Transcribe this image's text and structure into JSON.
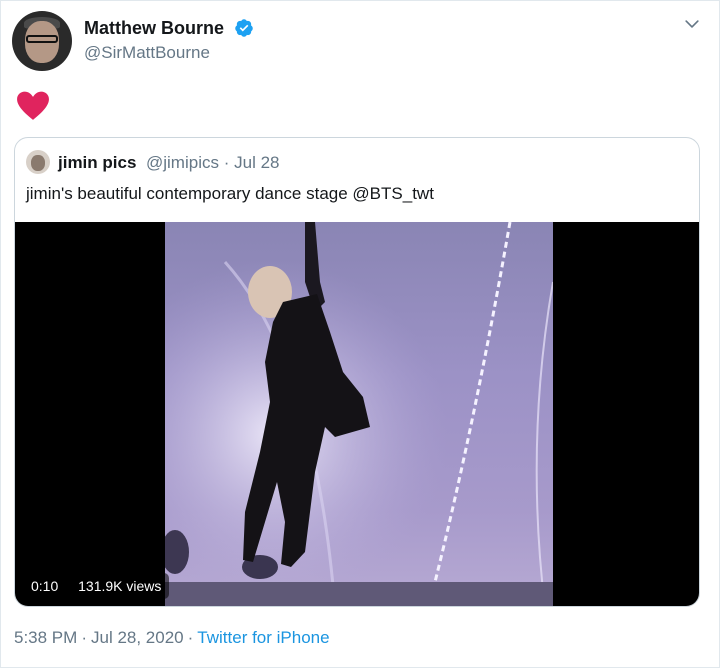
{
  "author": {
    "name": "Matthew Bourne",
    "handle": "@SirMattBourne",
    "verified_icon": "verified-badge-icon",
    "verified_color": "#1da1f2"
  },
  "tweet": {
    "content_icon": "red-heart-emoji",
    "heart_color": "#e0245e"
  },
  "quoted": {
    "name": "jimin pics",
    "handle": "@jimipics",
    "dot": "·",
    "date": "Jul 28",
    "text": "jimin's beautiful contemporary dance stage @BTS_twt",
    "video": {
      "duration": "0:10",
      "views": "131.9K views"
    }
  },
  "footer": {
    "time": "5:38 PM",
    "dot1": "·",
    "date": "Jul 28, 2020",
    "dot2": "·",
    "source": "Twitter for iPhone"
  },
  "colors": {
    "text_primary": "#14171a",
    "text_secondary": "#657786",
    "link": "#1b95e0",
    "border": "#ccd6dd"
  }
}
